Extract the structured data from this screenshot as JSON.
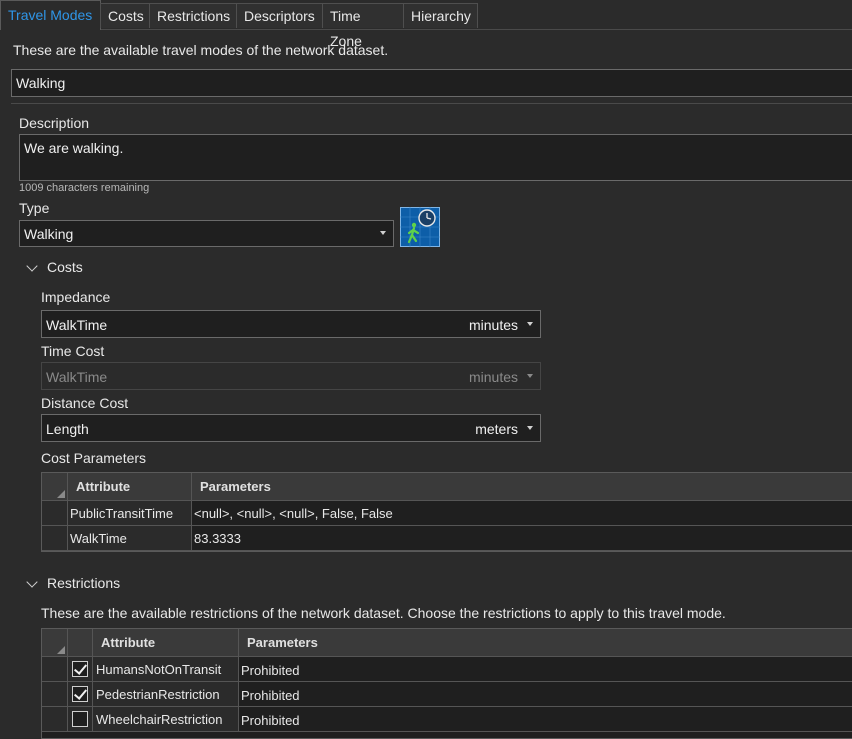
{
  "tabs": [
    "Travel Modes",
    "Costs",
    "Restrictions",
    "Descriptors",
    "Time Zone",
    "Hierarchy"
  ],
  "intro": "These are the available travel modes of the network dataset.",
  "travel_mode_name": "Walking",
  "description": {
    "label": "Description",
    "value": "We are walking.",
    "remaining": "1009 characters remaining"
  },
  "type": {
    "label": "Type",
    "value": "Walking",
    "icon": "pedestrian-clock-icon"
  },
  "costs": {
    "header": "Costs",
    "impedance": {
      "label": "Impedance",
      "value": "WalkTime",
      "unit": "minutes"
    },
    "time_cost": {
      "label": "Time Cost",
      "value": "WalkTime",
      "unit": "minutes"
    },
    "distance_cost": {
      "label": "Distance Cost",
      "value": "Length",
      "unit": "meters"
    },
    "parameters": {
      "label": "Cost Parameters",
      "columns": [
        "Attribute",
        "Parameters"
      ],
      "rows": [
        {
          "attribute": "PublicTransitTime",
          "parameters": "<null>, <null>, <null>, False, False"
        },
        {
          "attribute": "WalkTime",
          "parameters": "83.3333"
        }
      ]
    }
  },
  "restrictions": {
    "header": "Restrictions",
    "intro": "These are the available restrictions of the network dataset. Choose the restrictions to apply to this travel mode.",
    "columns": [
      "Attribute",
      "Parameters"
    ],
    "rows": [
      {
        "checked": true,
        "attribute": "HumansNotOnTransit",
        "parameters": "Prohibited"
      },
      {
        "checked": true,
        "attribute": "PedestrianRestriction",
        "parameters": "Prohibited"
      },
      {
        "checked": false,
        "attribute": "WheelchairRestriction",
        "parameters": "Prohibited"
      }
    ]
  },
  "colors": {
    "accent": "#2f96e8",
    "background": "#2b2b2b",
    "field": "#1f1f1f"
  }
}
